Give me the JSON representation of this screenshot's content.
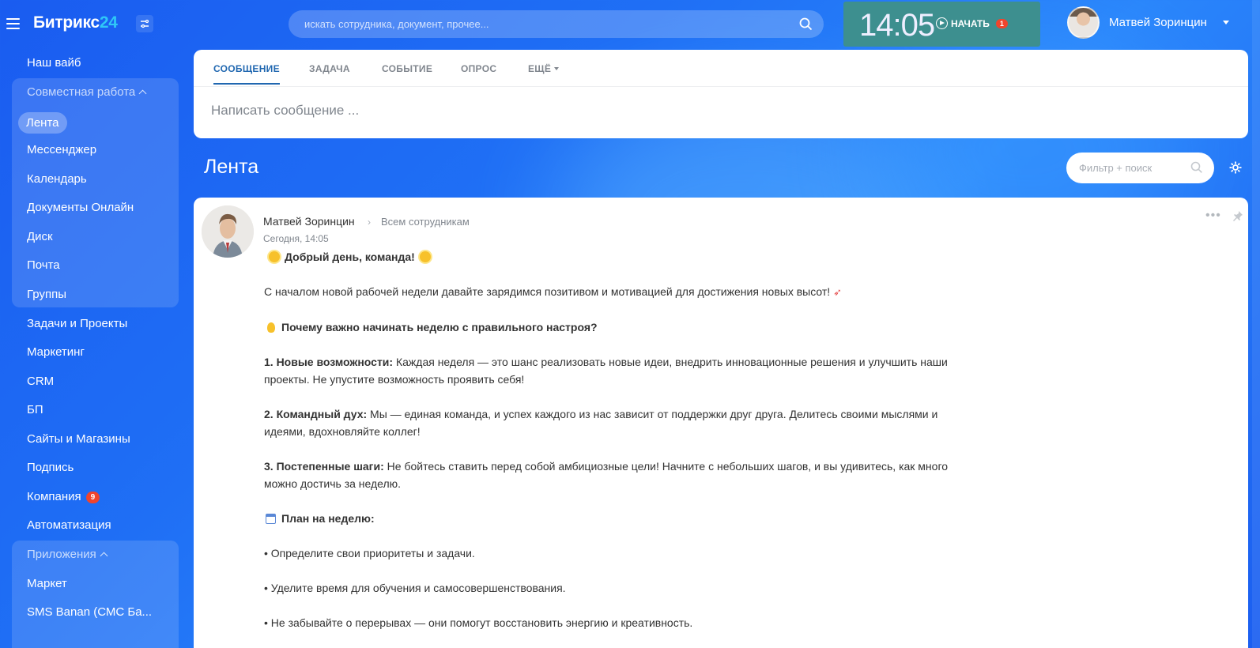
{
  "header": {
    "logo_text": "Битрикс",
    "logo_num": "24",
    "search_placeholder": "искать сотрудника, документ, прочее...",
    "clock": "14:05",
    "start_label": "НАЧАТЬ",
    "start_badge": "1",
    "user_name": "Матвей Зоринцин"
  },
  "sidebar": {
    "items": [
      {
        "label": "Наш вайб"
      },
      {
        "label": "Совместная работа"
      },
      {
        "label": "Лента"
      },
      {
        "label": "Мессенджер"
      },
      {
        "label": "Календарь"
      },
      {
        "label": "Документы Онлайн"
      },
      {
        "label": "Диск"
      },
      {
        "label": "Почта"
      },
      {
        "label": "Группы"
      },
      {
        "label": "Задачи и Проекты"
      },
      {
        "label": "Маркетинг"
      },
      {
        "label": "CRM"
      },
      {
        "label": "БП"
      },
      {
        "label": "Сайты и Магазины"
      },
      {
        "label": "Подпись"
      },
      {
        "label": "Компания",
        "badge": "9"
      },
      {
        "label": "Автоматизация"
      },
      {
        "label": "Приложения"
      },
      {
        "label": "Маркет"
      },
      {
        "label": "SMS Banan (СМС Ба..."
      }
    ]
  },
  "composer": {
    "tabs": [
      "СООБЩЕНИЕ",
      "ЗАДАЧА",
      "СОБЫТИЕ",
      "ОПРОС",
      "ЕЩЁ"
    ],
    "placeholder": "Написать сообщение ..."
  },
  "feed": {
    "title": "Лента",
    "filter_placeholder": "Фильтр + поиск"
  },
  "post": {
    "author": "Матвей Зоринцин",
    "audience": "Всем сотрудникам",
    "date": "Сегодня, 14:05",
    "greeting": "Добрый день, команда!",
    "intro": "С началом новой рабочей недели давайте зарядимся позитивом и мотивацией для достижения новых высот!",
    "why_title": "Почему важно начинать неделю с правильного настроя?",
    "p1_bold": "1. Новые возможности:",
    "p1_text": " Каждая неделя — это шанс реализовать новые идеи, внедрить инновационные решения и улучшить наши проекты. Не упустите возможность проявить себя!",
    "p2_bold": "2. Командный дух:",
    "p2_text": " Мы — единая команда, и успех каждого из нас зависит от поддержки друг друга. Делитесь своими мыслями и идеями, вдохновляйте коллег!",
    "p3_bold": "3. Постепенные шаги:",
    "p3_text": " Не бойтесь ставить перед собой амбициозные цели! Начните с небольших шагов, и вы удивитесь, как много можно достичь за неделю.",
    "plan_title": "План на неделю:",
    "b1": "• Определите свои приоритеты и задачи.",
    "b2": "• Уделите время для обучения и самосовершенствования.",
    "b3": "• Не забывайте о перерывах — они помогут восстановить энергию и креативность."
  }
}
